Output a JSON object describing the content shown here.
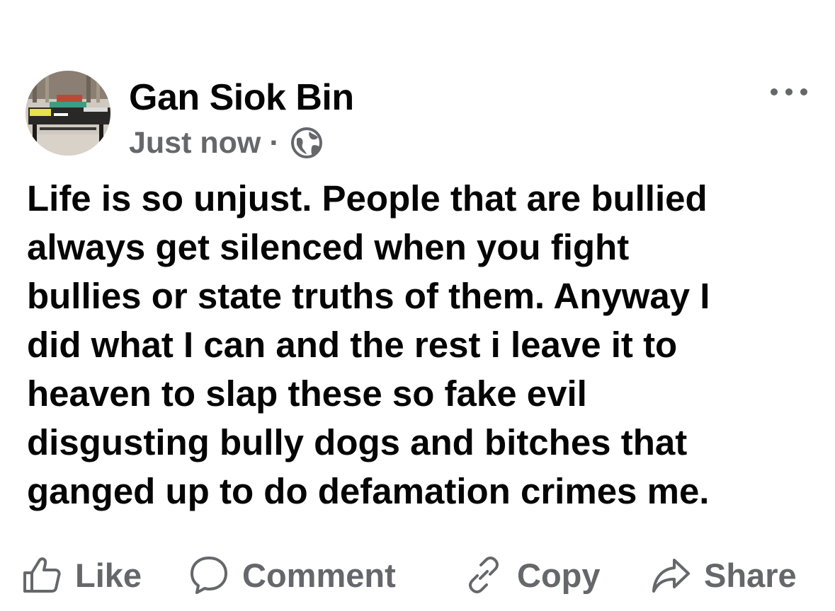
{
  "post": {
    "author": {
      "name": "Gan Siok Bin",
      "avatar_icon": "profile-photo-avatar"
    },
    "meta": {
      "time": "Just now",
      "separator": "·",
      "audience_icon": "globe-icon"
    },
    "more_icon": "ellipsis-icon",
    "text_lines": [
      "Life is so unjust. People that are bullied",
      "always get silenced when you fight",
      "bullies or state truths of them. Anyway I",
      "did what I can and the rest i leave it to",
      "heaven to slap these so fake evil",
      "disgusting bully dogs and bitches that",
      "ganged up to do defamation crimes me."
    ]
  },
  "actions": {
    "like": {
      "label": "Like",
      "icon": "thumbs-up-icon"
    },
    "comment": {
      "label": "Comment",
      "icon": "speech-bubble-icon"
    },
    "copy": {
      "label": "Copy",
      "icon": "link-icon"
    },
    "share": {
      "label": "Share",
      "icon": "share-arrow-icon"
    }
  },
  "colors": {
    "text": "#050505",
    "secondary": "#65676b",
    "background": "#ffffff"
  }
}
